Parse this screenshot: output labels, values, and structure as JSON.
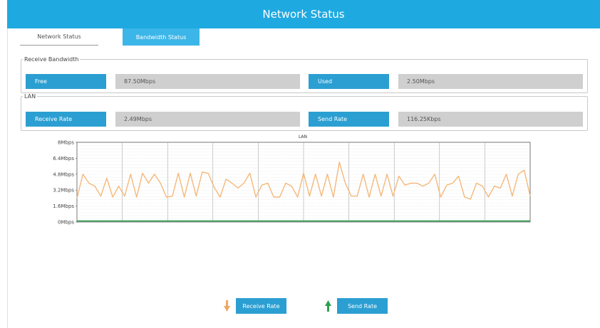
{
  "window": {
    "title": "Network Status"
  },
  "tabs": [
    {
      "label": "Network Status",
      "active": false
    },
    {
      "label": "Bandwidth Status",
      "active": true
    }
  ],
  "receive_bandwidth": {
    "legend": "Receive Bandwidth",
    "free_label": "Free",
    "free_value": "87.50Mbps",
    "used_label": "Used",
    "used_value": "2.50Mbps"
  },
  "lan": {
    "legend": "LAN",
    "receive_rate_label": "Receive Rate",
    "receive_rate_value": "2.49Mbps",
    "send_rate_label": "Send Rate",
    "send_rate_value": "116.25Kbps"
  },
  "colors": {
    "title_bar": "#1fa9e1",
    "label_bg": "#2b9fd2",
    "receive_line": "#f5b87a",
    "send_line": "#2e9e4f"
  },
  "legend": {
    "receive_label": "Receive Rate",
    "receive_icon": "arrow-down-icon",
    "send_label": "Send Rate",
    "send_icon": "arrow-up-icon"
  },
  "chart_data": {
    "type": "line",
    "title": "LAN",
    "y_unit": "Mbps",
    "ylim": [
      0,
      8
    ],
    "yticks": [
      "8Mbps",
      "6.4Mbps",
      "4.8Mbps",
      "3.2Mbps",
      "1.6Mbps",
      "0Mbps"
    ],
    "grid": true,
    "series": [
      {
        "name": "Receive Rate",
        "color": "#f5b87a",
        "values": [
          2.4,
          4.8,
          3.9,
          3.6,
          2.6,
          4.4,
          2.5,
          3.6,
          2.6,
          4.8,
          2.5,
          4.9,
          3.9,
          4.8,
          3.9,
          2.5,
          2.6,
          4.9,
          2.5,
          4.9,
          2.6,
          5.0,
          4.9,
          3.5,
          2.5,
          4.3,
          3.9,
          3.4,
          3.9,
          4.9,
          2.5,
          3.7,
          3.9,
          2.5,
          2.5,
          3.9,
          3.6,
          2.5,
          4.9,
          2.6,
          4.8,
          2.6,
          4.8,
          2.5,
          6.0,
          3.9,
          2.6,
          2.6,
          4.8,
          2.5,
          4.8,
          2.6,
          4.8,
          2.6,
          4.6,
          3.7,
          3.9,
          3.9,
          3.6,
          3.9,
          4.8,
          2.5,
          3.7,
          3.9,
          4.6,
          2.5,
          2.3,
          3.9,
          3.6,
          2.5,
          3.6,
          3.4,
          4.8,
          2.6,
          4.8,
          5.2,
          2.6
        ],
        "last_value": 2.49
      },
      {
        "name": "Send Rate",
        "color": "#2e9e4f",
        "values": [
          0.1,
          0.1,
          0.1,
          0.1,
          0.1,
          0.1,
          0.1,
          0.1,
          0.1,
          0.1,
          0.1,
          0.1,
          0.1,
          0.1,
          0.1,
          0.1,
          0.1,
          0.1,
          0.1,
          0.1,
          0.1,
          0.1,
          0.1,
          0.1,
          0.1,
          0.1,
          0.1,
          0.1,
          0.1,
          0.1,
          0.1,
          0.1,
          0.1,
          0.1,
          0.1,
          0.1,
          0.1,
          0.1,
          0.1,
          0.1,
          0.1,
          0.1,
          0.1,
          0.1,
          0.1,
          0.1,
          0.1,
          0.1,
          0.1,
          0.1,
          0.1,
          0.1,
          0.1,
          0.1,
          0.1,
          0.1,
          0.1,
          0.1,
          0.1,
          0.1,
          0.1,
          0.1,
          0.1,
          0.1,
          0.1,
          0.1,
          0.1,
          0.1,
          0.1,
          0.1,
          0.1,
          0.1,
          0.1,
          0.1,
          0.1,
          0.1,
          0.1
        ]
      }
    ]
  }
}
